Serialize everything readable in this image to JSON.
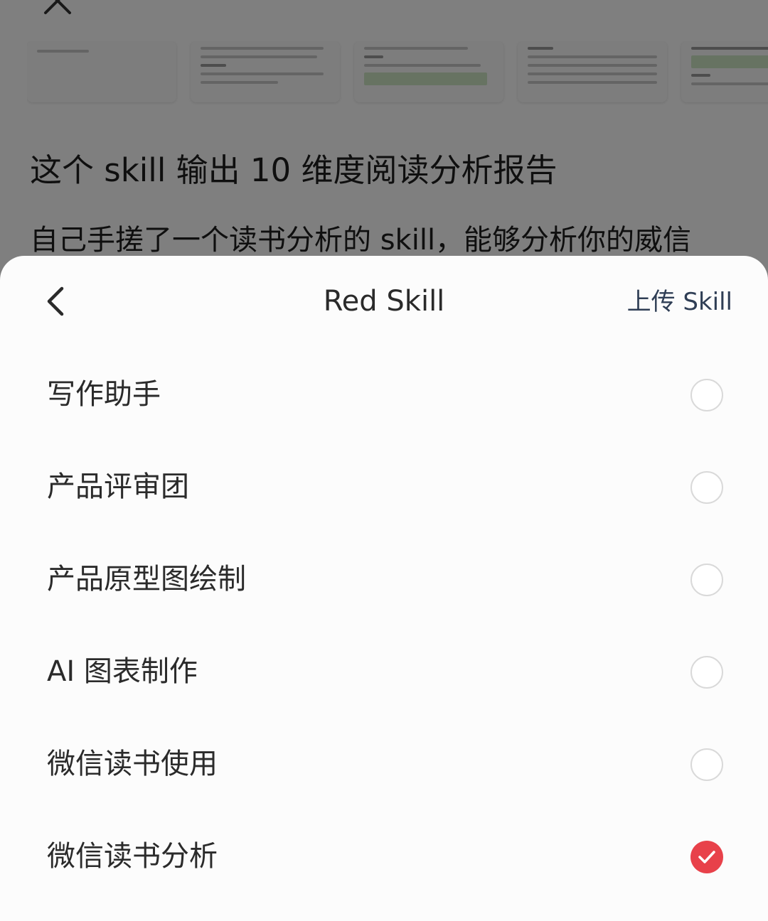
{
  "background": {
    "title": "这个 skill 输出 10 维度阅读分析报告",
    "body": "自己手搓了一个读书分析的 skill，能够分析你的威信"
  },
  "sheet": {
    "title": "Red Skill",
    "upload_label": "上传 Skill",
    "back_icon": "chevron-left-icon",
    "items": [
      {
        "label": "写作助手",
        "selected": false
      },
      {
        "label": "产品评审团",
        "selected": false
      },
      {
        "label": "产品原型图绘制",
        "selected": false
      },
      {
        "label": "AI 图表制作",
        "selected": false
      },
      {
        "label": "微信读书使用",
        "selected": false
      },
      {
        "label": "微信读书分析",
        "selected": true
      }
    ]
  },
  "colors": {
    "accent": "#e8414a",
    "link": "#2f3e55",
    "radio_border": "#d9d9d9"
  }
}
